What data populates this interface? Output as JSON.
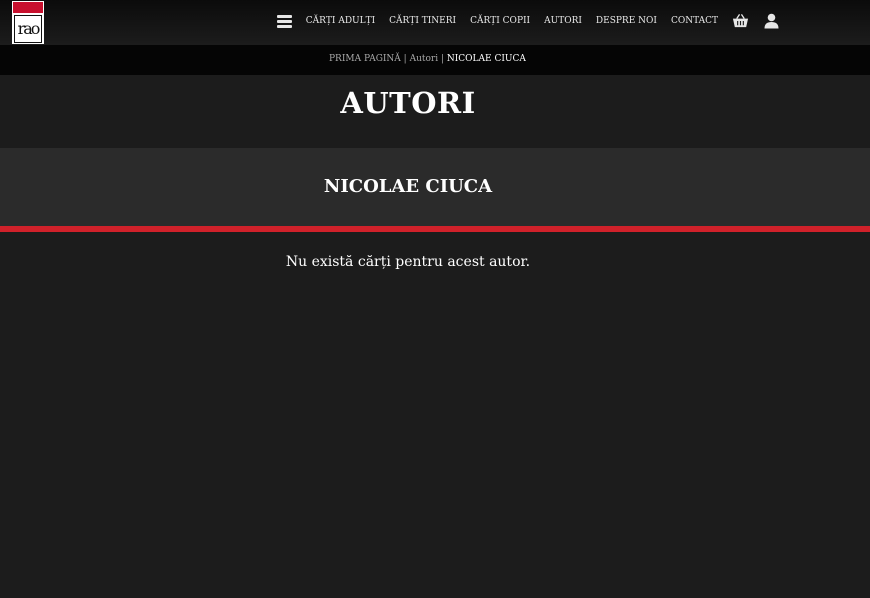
{
  "logo": {
    "text": "rao"
  },
  "nav": {
    "items": [
      {
        "label": "CĂRȚI ADULȚI"
      },
      {
        "label": "CĂRȚI TINERI"
      },
      {
        "label": "CĂRȚI COPII"
      },
      {
        "label": "AUTORI"
      },
      {
        "label": "DESPRE NOI"
      },
      {
        "label": "CONTACT"
      }
    ],
    "icons": [
      "menu-icon",
      "basket-icon",
      "user-icon"
    ]
  },
  "breadcrumb": {
    "home": "PRIMA PAGINĂ",
    "separator": " | ",
    "section": "Autori",
    "current": "NICOLAE CIUCA"
  },
  "page": {
    "title": "AUTORI",
    "author_name": "NICOLAE CIUCA",
    "empty_message": "Nu există cărți pentru acest autor."
  },
  "colors": {
    "accent": "#d0212a",
    "background": "#1c1c1c",
    "band": "#2b2b2b"
  }
}
